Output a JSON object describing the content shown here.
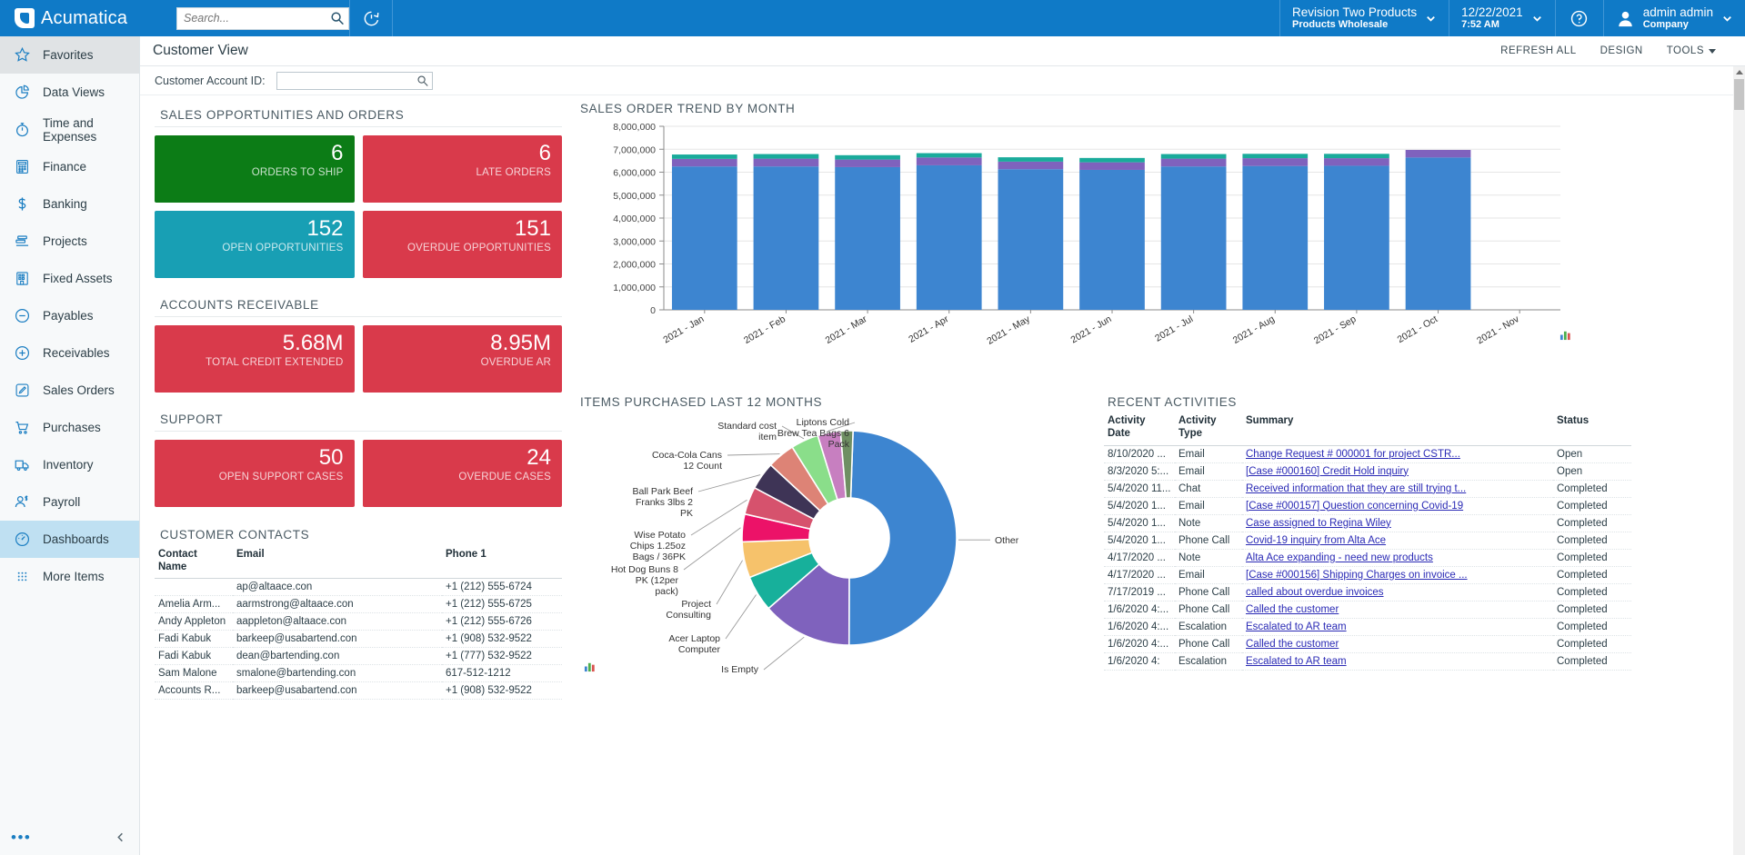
{
  "topbar": {
    "brand": "Acumatica",
    "brand_icon": "acumatica-logo-icon",
    "search_placeholder": "Search...",
    "search_value": "",
    "search_icon": "search-icon",
    "recent_icon": "recent-history-icon",
    "tenant_name": "Revision Two Products",
    "tenant_sub": "Products Wholesale",
    "tenant_chevron_icon": "chevron-down-icon",
    "date": "12/22/2021",
    "time": "7:52 AM",
    "date_chevron_icon": "chevron-down-icon",
    "help_icon": "help-circle-icon",
    "user_icon": "user-avatar-icon",
    "user_name": "admin admin",
    "user_sub": "Company",
    "user_chevron_icon": "chevron-down-icon",
    "accent_color": "#0f7ac7"
  },
  "sidebar": {
    "items": [
      {
        "label": "Favorites",
        "icon": "star-icon",
        "state": "hover"
      },
      {
        "label": "Data Views",
        "icon": "pie-chart-icon",
        "state": "normal"
      },
      {
        "label": "Time and Expenses",
        "icon": "stopwatch-icon",
        "state": "normal"
      },
      {
        "label": "Finance",
        "icon": "calculator-icon",
        "state": "normal"
      },
      {
        "label": "Banking",
        "icon": "dollar-sign-icon",
        "state": "normal"
      },
      {
        "label": "Projects",
        "icon": "gantt-bars-icon",
        "state": "normal"
      },
      {
        "label": "Fixed Assets",
        "icon": "building-icon",
        "state": "normal"
      },
      {
        "label": "Payables",
        "icon": "minus-circle-icon",
        "state": "normal"
      },
      {
        "label": "Receivables",
        "icon": "plus-circle-icon",
        "state": "normal"
      },
      {
        "label": "Sales Orders",
        "icon": "pencil-square-icon",
        "state": "normal"
      },
      {
        "label": "Purchases",
        "icon": "shopping-cart-icon",
        "state": "normal"
      },
      {
        "label": "Inventory",
        "icon": "truck-icon",
        "state": "normal"
      },
      {
        "label": "Payroll",
        "icon": "person-dollar-icon",
        "state": "normal"
      },
      {
        "label": "Dashboards",
        "icon": "gauge-icon",
        "state": "active"
      },
      {
        "label": "More Items",
        "icon": "grid-dots-icon",
        "state": "normal"
      }
    ],
    "more_icon": "ellipsis-icon",
    "collapse_icon": "chevron-left-icon"
  },
  "page": {
    "title": "Customer View",
    "actions": [
      {
        "label": "REFRESH ALL",
        "name": "refresh-all-button"
      },
      {
        "label": "DESIGN",
        "name": "design-button"
      },
      {
        "label": "TOOLS",
        "name": "tools-button",
        "has_caret": true
      }
    ],
    "filter": {
      "label": "Customer Account ID:",
      "value": "",
      "placeholder": "",
      "search_icon": "magnifier-icon"
    }
  },
  "sections": {
    "sales": {
      "title": "SALES OPPORTUNITIES AND ORDERS",
      "tiles": [
        {
          "value": "6",
          "label": "ORDERS TO SHIP",
          "color": "#0c7c16"
        },
        {
          "value": "6",
          "label": "LATE ORDERS",
          "color": "#d93a4b"
        },
        {
          "value": "152",
          "label": "OPEN OPPORTUNITIES",
          "color": "#189fb4"
        },
        {
          "value": "151",
          "label": "OVERDUE OPPORTUNITIES",
          "color": "#d93a4b"
        }
      ]
    },
    "ar": {
      "title": "ACCOUNTS RECEIVABLE",
      "tiles": [
        {
          "value": "5.68M",
          "label": "TOTAL CREDIT EXTENDED",
          "color": "#d93a4b"
        },
        {
          "value": "8.95M",
          "label": "OVERDUE AR",
          "color": "#d93a4b"
        }
      ]
    },
    "support": {
      "title": "SUPPORT",
      "tiles": [
        {
          "value": "50",
          "label": "OPEN SUPPORT CASES",
          "color": "#d93a4b"
        },
        {
          "value": "24",
          "label": "OVERDUE CASES",
          "color": "#d93a4b"
        }
      ]
    },
    "contacts": {
      "title": "CUSTOMER CONTACTS",
      "columns": [
        "Contact Name",
        "Email",
        "Phone 1"
      ],
      "rows": [
        {
          "name": "",
          "email": "ap@altaace.con",
          "phone": "+1 (212) 555-6724"
        },
        {
          "name": "Amelia Arm...",
          "email": "aarmstrong@altaace.con",
          "phone": "+1 (212) 555-6725"
        },
        {
          "name": "Andy Appleton",
          "email": "aappleton@altaace.con",
          "phone": "+1 (212) 555-6726"
        },
        {
          "name": "Fadi Kabuk",
          "email": "barkeep@usabartend.con",
          "phone": "+1 (908) 532-9522"
        },
        {
          "name": "Fadi Kabuk",
          "email": "dean@bartending.con",
          "phone": "+1 (777) 532-9522"
        },
        {
          "name": "Sam Malone",
          "email": "smalone@bartending.con",
          "phone": "617-512-1212"
        },
        {
          "name": "Accounts R...",
          "email": "barkeep@usabartend.con",
          "phone": "+1 (908) 532-9522"
        }
      ]
    },
    "activities": {
      "title": "RECENT ACTIVITIES",
      "columns": [
        "Activity Date",
        "Activity Type",
        "Summary",
        "Status"
      ],
      "rows": [
        {
          "date": "8/10/2020 ...",
          "type": "Email",
          "summary": "Change Request # 000001 for project CSTR...",
          "status": "Open"
        },
        {
          "date": "8/3/2020 5:...",
          "type": "Email",
          "summary": "[Case #000160] Credit Hold inquiry",
          "status": "Open"
        },
        {
          "date": "5/4/2020 11...",
          "type": "Chat",
          "summary": "Received information that they are still trying t...",
          "status": "Completed"
        },
        {
          "date": "5/4/2020 1...",
          "type": "Email",
          "summary": "[Case #000157] Question concerning Covid-19",
          "status": "Completed"
        },
        {
          "date": "5/4/2020 1...",
          "type": "Note",
          "summary": "Case assigned to Regina Wiley",
          "status": "Completed"
        },
        {
          "date": "5/4/2020 1...",
          "type": "Phone Call",
          "summary": "Covid-19 inquiry from Alta Ace",
          "status": "Completed"
        },
        {
          "date": "4/17/2020 ...",
          "type": "Note",
          "summary": "Alta Ace expanding - need new products",
          "status": "Completed"
        },
        {
          "date": "4/17/2020 ...",
          "type": "Email",
          "summary": "[Case #000156] Shipping Charges on invoice ...",
          "status": "Completed"
        },
        {
          "date": "7/17/2019 ...",
          "type": "Phone Call",
          "summary": "called about overdue invoices",
          "status": "Completed"
        },
        {
          "date": "1/6/2020 4:...",
          "type": "Phone Call",
          "summary": "Called the customer",
          "status": "Completed"
        },
        {
          "date": "1/6/2020 4:...",
          "type": "Escalation",
          "summary": "Escalated to AR team",
          "status": "Completed"
        },
        {
          "date": "1/6/2020 4:...",
          "type": "Phone Call",
          "summary": "Called the customer",
          "status": "Completed"
        },
        {
          "date": "1/6/2020 4:",
          "type": "Escalation",
          "summary": "Escalated to AR team",
          "status": "Completed"
        }
      ]
    }
  },
  "chart_data": [
    {
      "type": "bar",
      "name": "sales-order-trend-by-month",
      "title": "SALES ORDER TREND BY MONTH",
      "stacked": true,
      "xlabel": "",
      "ylabel": "",
      "ylim": [
        0,
        8000000
      ],
      "yticks": [
        0,
        1000000,
        2000000,
        3000000,
        4000000,
        5000000,
        6000000,
        7000000,
        8000000
      ],
      "ytick_labels": [
        "0",
        "1,000,000",
        "2,000,000",
        "3,000,000",
        "4,000,000",
        "5,000,000",
        "6,000,000",
        "7,000,000",
        "8,000,000"
      ],
      "grid": true,
      "legend": "none",
      "categories": [
        "2021 - Jan",
        "2021 - Feb",
        "2021 - Mar",
        "2021 - Apr",
        "2021 - May",
        "2021 - Jun",
        "2021 - Jul",
        "2021 - Aug",
        "2021 - Sep",
        "2021 - Oct",
        "2021 - Nov"
      ],
      "series": [
        {
          "name": "segment-1",
          "color": "#3d85d0",
          "values": [
            6250000,
            6250000,
            6220000,
            6300000,
            6130000,
            6100000,
            6250000,
            6270000,
            6280000,
            6640000,
            0
          ]
        },
        {
          "name": "segment-2",
          "color": "#7f62bd",
          "values": [
            330000,
            340000,
            330000,
            340000,
            330000,
            330000,
            340000,
            340000,
            330000,
            330000,
            0
          ]
        },
        {
          "name": "segment-3",
          "color": "#1aab9b",
          "values": [
            190000,
            200000,
            190000,
            190000,
            190000,
            190000,
            200000,
            190000,
            190000,
            0,
            0
          ]
        }
      ],
      "export_icon": "chart-export-icon"
    },
    {
      "type": "pie",
      "name": "items-purchased-last-12-months",
      "title": "ITEMS PURCHASED LAST 12 MONTHS",
      "donut": true,
      "legend": "labels-outside",
      "labels": [
        "Other",
        "Is Empty",
        "Acer Laptop Computer",
        "Project Consulting",
        "Hot Dog Buns 8 PK (12per pack)",
        "Wise Potato Chips 1.25oz Bags / 36PK",
        "Ball Park Beef Franks 3lbs 2 PK",
        "Coca-Cola Cans 12 Count",
        "Standard cost item",
        "Liptons Cold Brew Tea Bags 6 Pack",
        "Unlabeled slice"
      ],
      "values": [
        47.5,
        13.0,
        5.2,
        5.2,
        4.0,
        4.0,
        4.0,
        4.0,
        4.0,
        3.3,
        1.8
      ],
      "colors": [
        "#3d85d0",
        "#7f62bd",
        "#17b09b",
        "#f6c26b",
        "#ec1268",
        "#d6526d",
        "#3e3456",
        "#dd8376",
        "#8ade8a",
        "#c77fc0",
        "#6f8f63"
      ],
      "export_icon": "chart-export-icon"
    }
  ],
  "scrollbar": {
    "up_icon": "scroll-up-arrow-icon"
  }
}
